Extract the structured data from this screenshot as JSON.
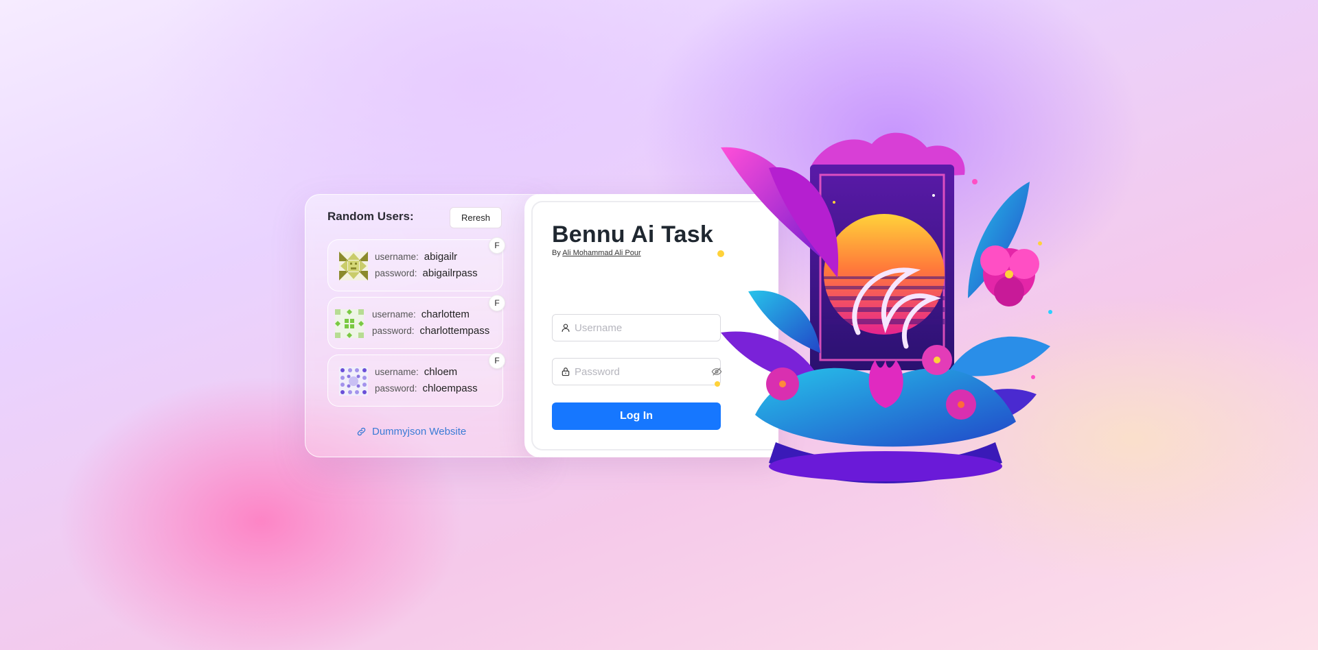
{
  "users_panel": {
    "title": "Random Users:",
    "refresh_label": "Reresh",
    "username_label": "username:",
    "password_label": "password:",
    "users": [
      {
        "username": "abigailr",
        "password": "abigailrpass",
        "gender": "F",
        "avatar_color": "#9aa83a"
      },
      {
        "username": "charlottem",
        "password": "charlottempass",
        "gender": "F",
        "avatar_color": "#7ac943"
      },
      {
        "username": "chloem",
        "password": "chloempass",
        "gender": "F",
        "avatar_color": "#6a4fd8"
      }
    ],
    "link_label": "Dummyjson Website"
  },
  "login": {
    "title": "Bennu Ai Task",
    "by_prefix": "By",
    "author": "Ali Mohammad Ali Pour",
    "username_placeholder": "Username",
    "password_placeholder": "Password",
    "submit_label": "Log In"
  },
  "colors": {
    "primary": "#1677ff",
    "link": "#3a7bd5"
  },
  "icons": {
    "username_field": "user-icon",
    "password_field": "lock-icon",
    "password_toggle": "eye-off-icon",
    "link": "link-icon"
  }
}
